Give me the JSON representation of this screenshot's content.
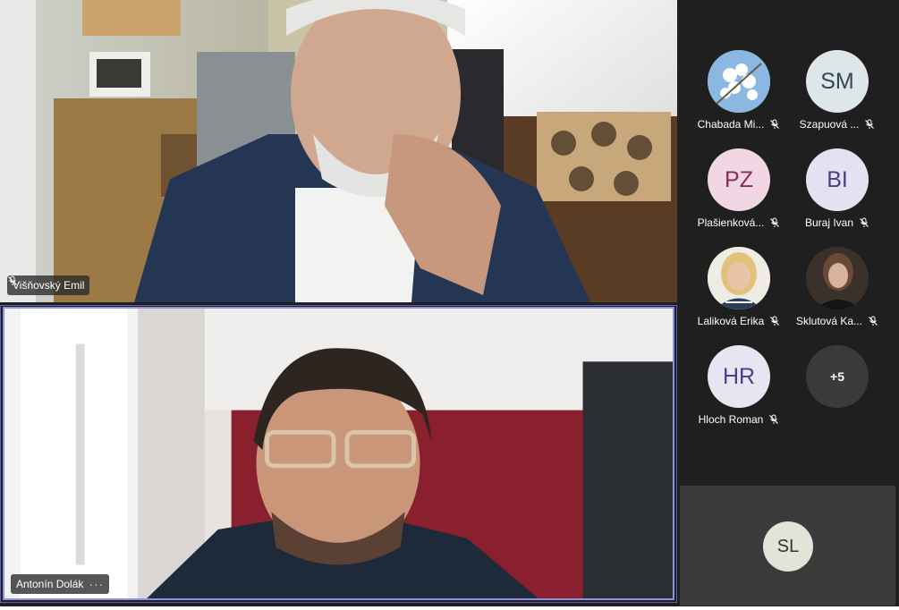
{
  "meeting": {
    "main_participants": [
      {
        "name": "Višňovský Emil",
        "muted": true
      },
      {
        "name": "Antonín Dolák",
        "more": "···"
      }
    ],
    "roster": [
      {
        "name": "Chabada Mi...",
        "avatar_type": "photo",
        "muted": true
      },
      {
        "name": "Szapuová ...",
        "initials": "SM",
        "avatar_color": "#dfe6e9",
        "initials_color": "#2f4858",
        "muted": true
      },
      {
        "name": "Plašienková...",
        "initials": "PZ",
        "avatar_color": "#f1d6e4",
        "initials_color": "#8a2b5d",
        "muted": true
      },
      {
        "name": "Buraj Ivan",
        "initials": "BI",
        "avatar_color": "#e5e1f2",
        "initials_color": "#4b3f8a",
        "muted": true
      },
      {
        "name": "Laliková Erika",
        "avatar_type": "photo",
        "muted": true
      },
      {
        "name": "Sklutová Ka...",
        "avatar_type": "photo",
        "muted": true
      },
      {
        "name": "Hloch Roman",
        "initials": "HR",
        "avatar_color": "#e8e5f3",
        "initials_color": "#4b3f8a",
        "muted": true
      }
    ],
    "overflow_label": "+5",
    "self_initials": "SL"
  },
  "icons": {
    "muted": "mic-off-icon",
    "more": "more-dots-icon"
  },
  "colors": {
    "stage_bg": "#1f1f1f",
    "active_speaker_border": "#8e90e6",
    "tile_bg": "#3b3b3b"
  }
}
